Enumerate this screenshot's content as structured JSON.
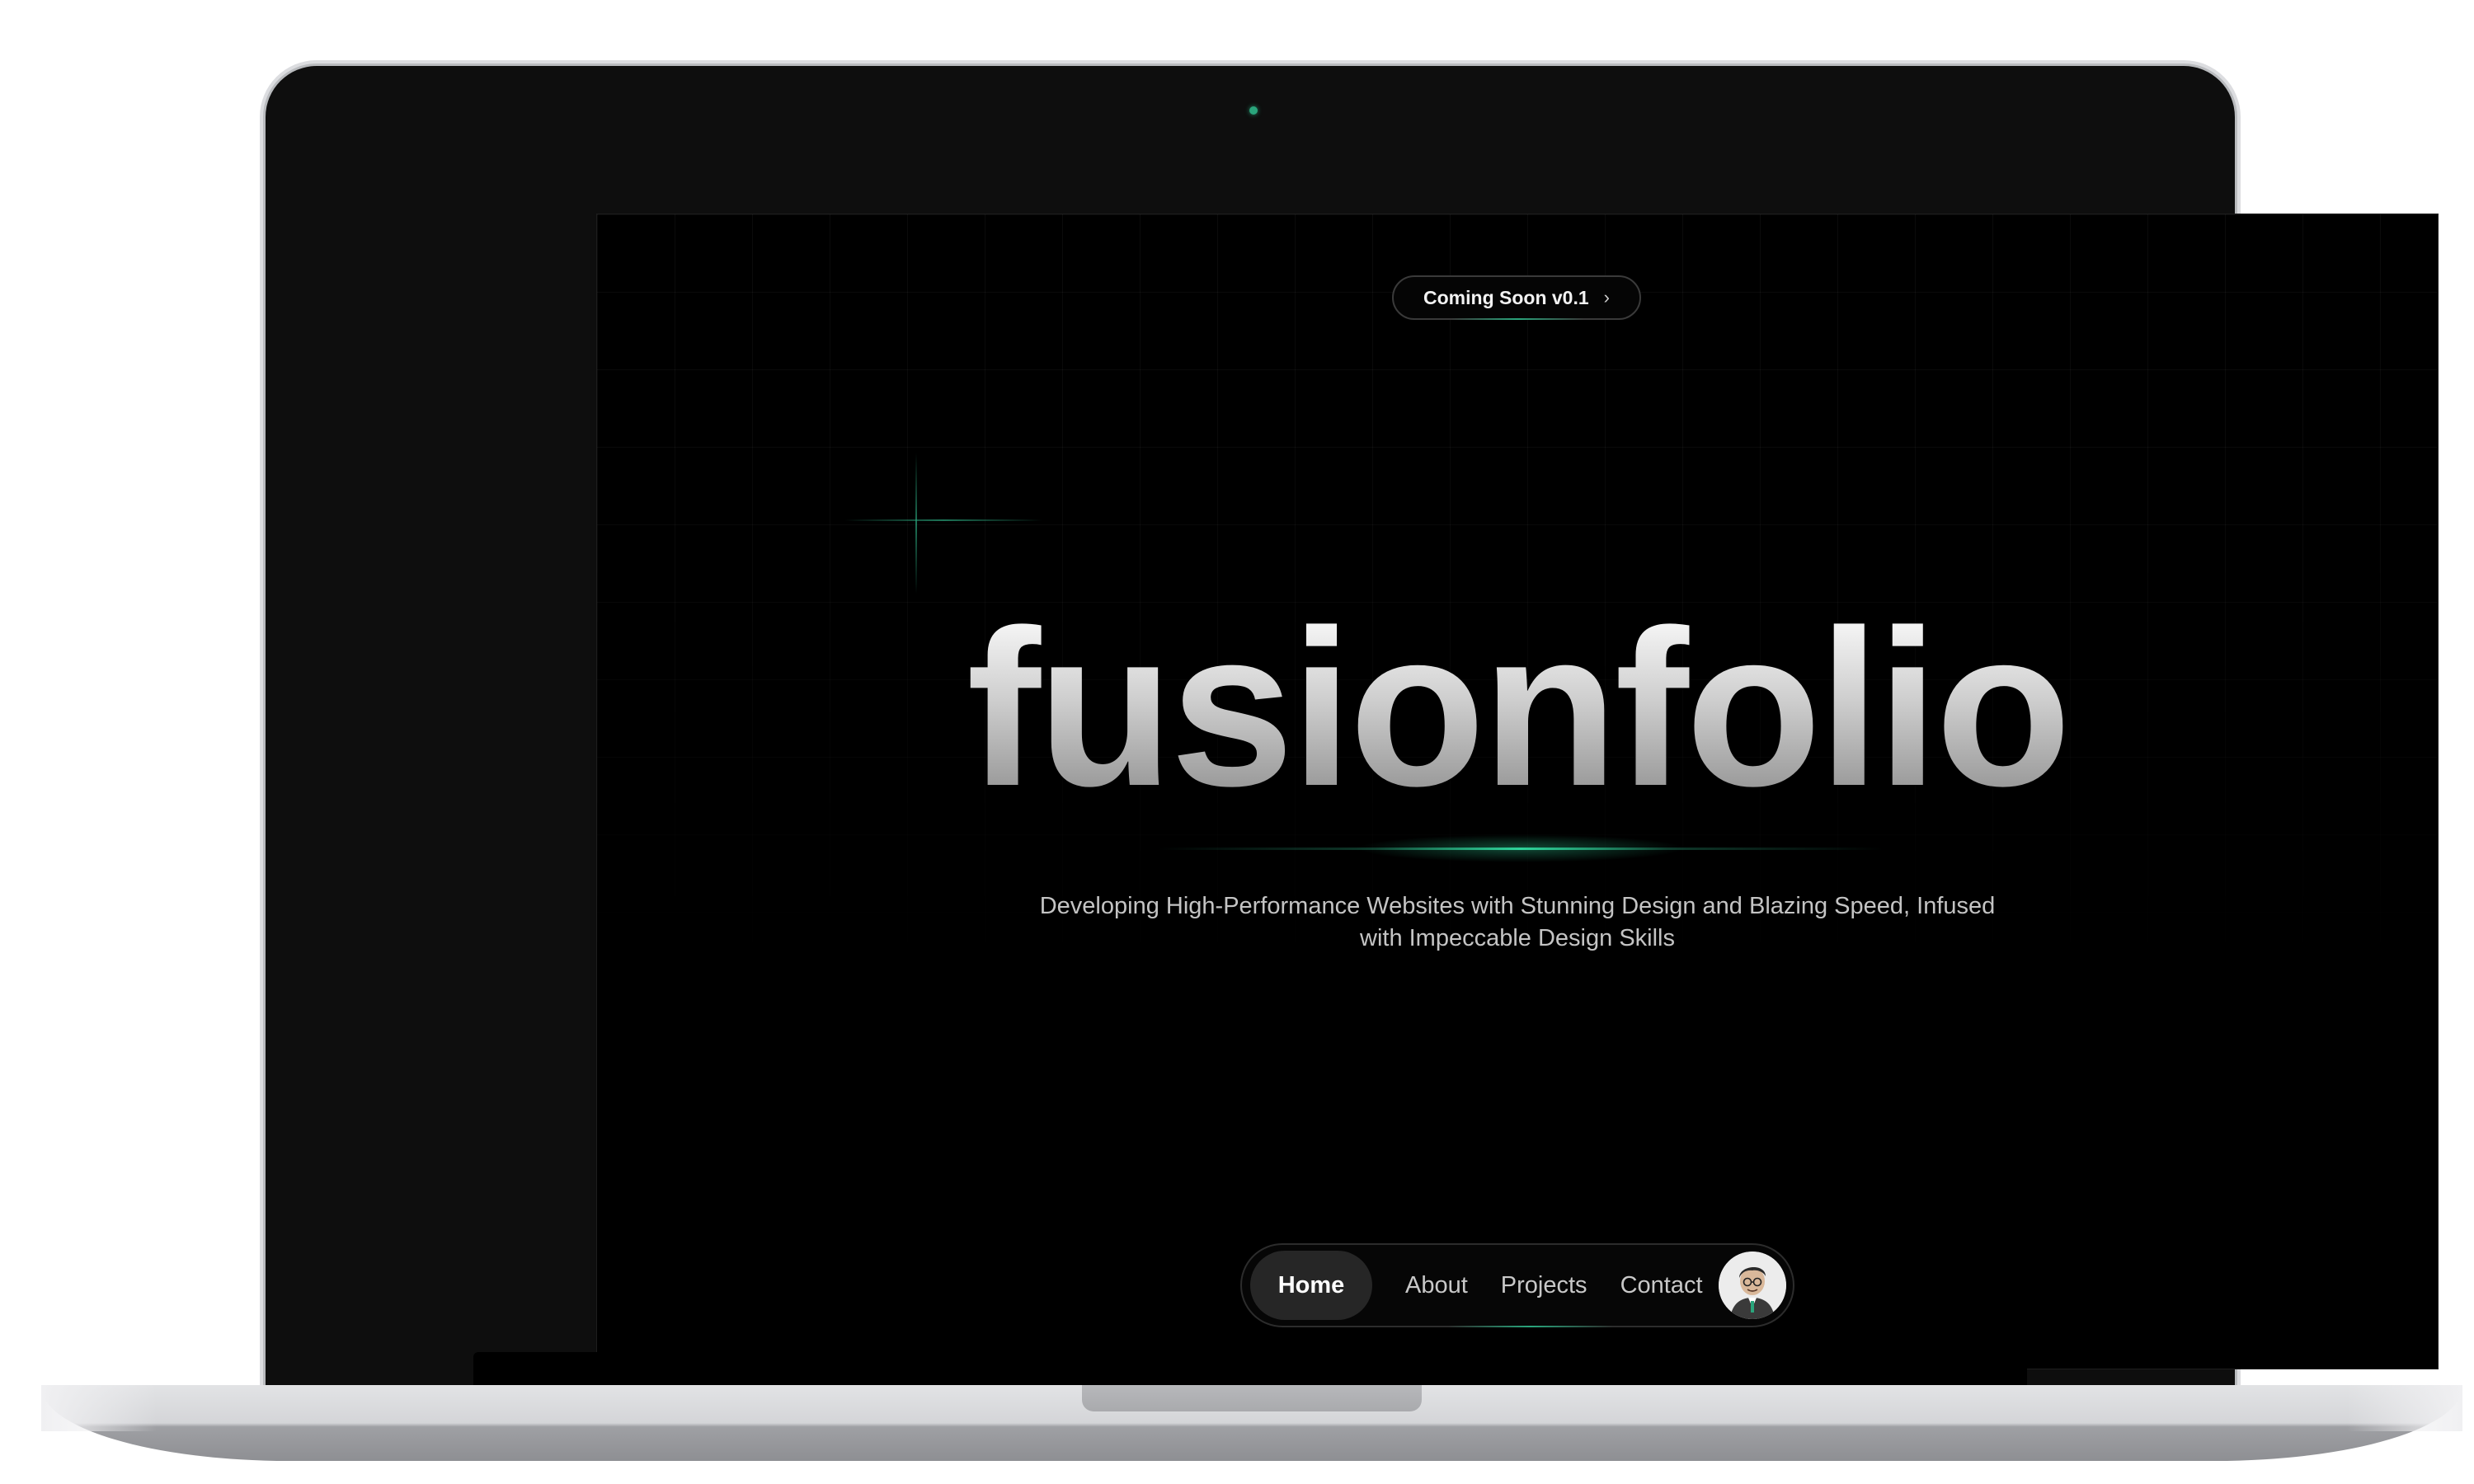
{
  "pill": {
    "label": "Coming Soon v0.1",
    "chevron": "›"
  },
  "hero": {
    "title": "fusionfolio",
    "subtitle_line1": "Developing High-Performance Websites with Stunning Design and Blazing Speed, Infused",
    "subtitle_line2": "with Impeccable Design Skills"
  },
  "nav": {
    "items": [
      {
        "label": "Home",
        "active": true
      },
      {
        "label": "About",
        "active": false
      },
      {
        "label": "Projects",
        "active": false
      },
      {
        "label": "Contact",
        "active": false
      }
    ],
    "avatar_icon": "user-avatar-icon"
  },
  "colors": {
    "accent": "#2aa57c",
    "background": "#000000",
    "lid": "#0e0e0e"
  }
}
